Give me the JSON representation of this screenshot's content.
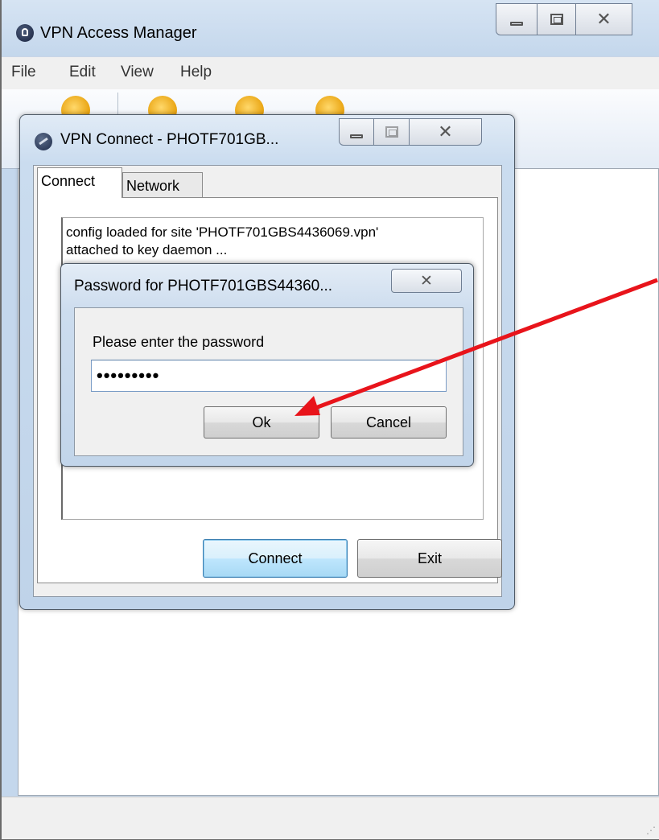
{
  "main_window": {
    "title": "VPN Access Manager",
    "menu": [
      "File",
      "Edit",
      "View",
      "Help"
    ],
    "icons": {
      "app": "padlock-icon",
      "minimize": "minimize-icon",
      "maximize": "maximize-icon",
      "close": "close-icon"
    },
    "toolbar_icons": [
      "connect-icon",
      "add-icon",
      "edit-icon",
      "remove-icon"
    ]
  },
  "vpn_window": {
    "title": "VPN Connect - PHOTF701GB...",
    "tabs": [
      {
        "label": "Connect",
        "active": true
      },
      {
        "label": "Network",
        "active": false
      }
    ],
    "log_lines": [
      "config loaded for site 'PHOTF701GBS4436069.vpn'",
      "attached to key daemon ..."
    ],
    "buttons": {
      "connect": "Connect",
      "exit": "Exit"
    }
  },
  "password_dialog": {
    "title": "Password for PHOTF701GBS44360...",
    "prompt": "Please enter the password",
    "password_value": "•••••••••",
    "buttons": {
      "ok": "Ok",
      "cancel": "Cancel"
    }
  },
  "annotation": {
    "color": "#e8141b"
  },
  "colors": {
    "accent_blue": "#3c7fb1",
    "chrome_blue": "#c4d7ec"
  }
}
